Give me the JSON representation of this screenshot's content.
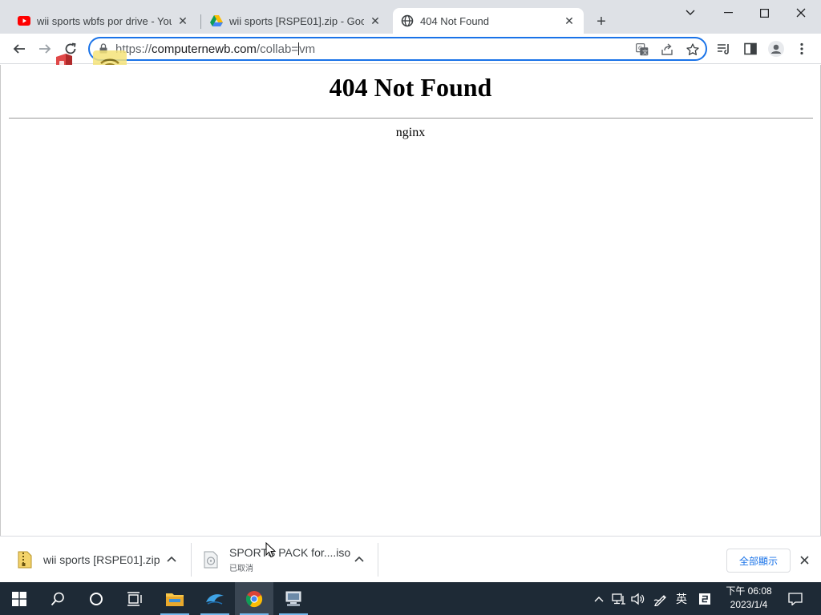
{
  "browser": {
    "tabs": [
      {
        "title": "wii sports wbfs por drive - YouTube",
        "favicon": "youtube-icon",
        "active": false
      },
      {
        "title": "wii sports [RSPE01].zip - Google Drive",
        "favicon": "google-drive-icon",
        "active": false
      },
      {
        "title": "404 Not Found",
        "favicon": "globe-icon",
        "active": true
      }
    ],
    "url": {
      "scheme": "https://",
      "host": "computernewb.com",
      "path_before_caret": "/collab=",
      "path_after_caret": "vm"
    }
  },
  "page": {
    "heading": "404 Not Found",
    "server": "nginx"
  },
  "downloads": {
    "items": [
      {
        "name": "wii sports [RSPE01].zip",
        "status": "",
        "icon": "zip-file-icon"
      },
      {
        "name": "SPORTS PACK for....iso",
        "status": "已取消",
        "icon": "disc-file-icon"
      }
    ],
    "show_all": "全部顯示"
  },
  "taskbar": {
    "ime_language": "英",
    "clock_time": "下午 06:08",
    "clock_date": "2023/1/4"
  },
  "colors": {
    "accent": "#1a73e8",
    "tabstrip": "#dee1e6",
    "taskbar": "#1e2a36",
    "youtube_red": "#ff0000"
  }
}
